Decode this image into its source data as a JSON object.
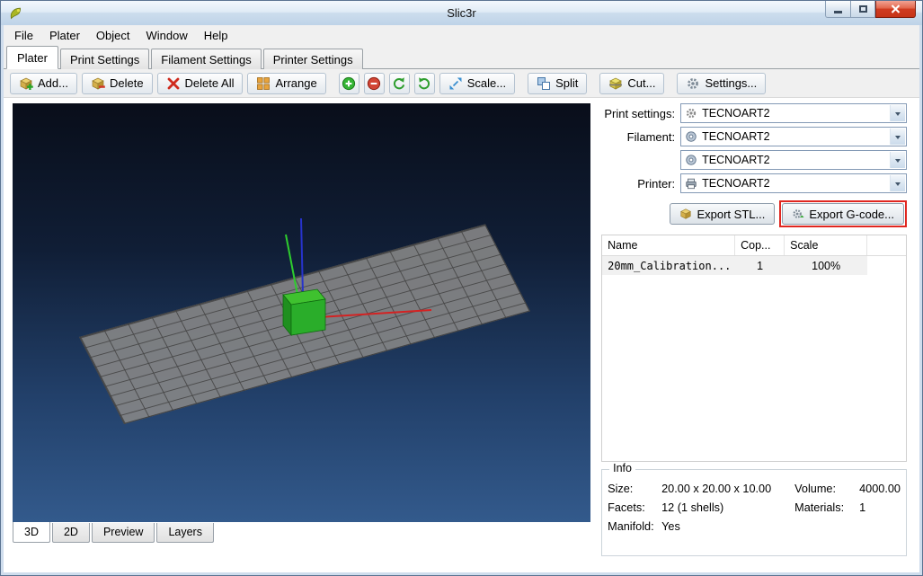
{
  "window": {
    "title": "Slic3r"
  },
  "menu": {
    "items": [
      "File",
      "Plater",
      "Object",
      "Window",
      "Help"
    ]
  },
  "tabs": {
    "items": [
      "Plater",
      "Print Settings",
      "Filament Settings",
      "Printer Settings"
    ],
    "active": "Plater"
  },
  "toolbar": {
    "add": "Add...",
    "delete": "Delete",
    "delete_all": "Delete All",
    "arrange": "Arrange",
    "scale": "Scale...",
    "split": "Split",
    "cut": "Cut...",
    "settings": "Settings..."
  },
  "sidebar": {
    "print_settings_label": "Print settings:",
    "filament_label": "Filament:",
    "printer_label": "Printer:",
    "combo_values": {
      "print": "TECNOART2",
      "filament1": "TECNOART2",
      "filament2": "TECNOART2",
      "printer": "TECNOART2"
    },
    "export_stl": "Export STL...",
    "export_gcode": "Export G-code..."
  },
  "object_table": {
    "headers": {
      "name": "Name",
      "copies": "Cop...",
      "scale": "Scale"
    },
    "row": {
      "name": "20mm_Calibration...",
      "copies": "1",
      "scale": "100%"
    }
  },
  "info": {
    "title": "Info",
    "size_label": "Size:",
    "size_value": "20.00 x 20.00 x 10.00",
    "volume_label": "Volume:",
    "volume_value": "4000.00",
    "facets_label": "Facets:",
    "facets_value": "12 (1 shells)",
    "materials_label": "Materials:",
    "materials_value": "1",
    "manifold_label": "Manifold:",
    "manifold_value": "Yes"
  },
  "view_tabs": {
    "items": [
      "3D",
      "2D",
      "Preview",
      "Layers"
    ],
    "active": "3D"
  },
  "colors": {
    "highlight_red": "#e0261f",
    "cube_green": "#2aad2a",
    "axis_red": "#d42222",
    "axis_green": "#2ecc2e",
    "axis_blue": "#2733cc",
    "close_button_red": "#d03b20"
  }
}
